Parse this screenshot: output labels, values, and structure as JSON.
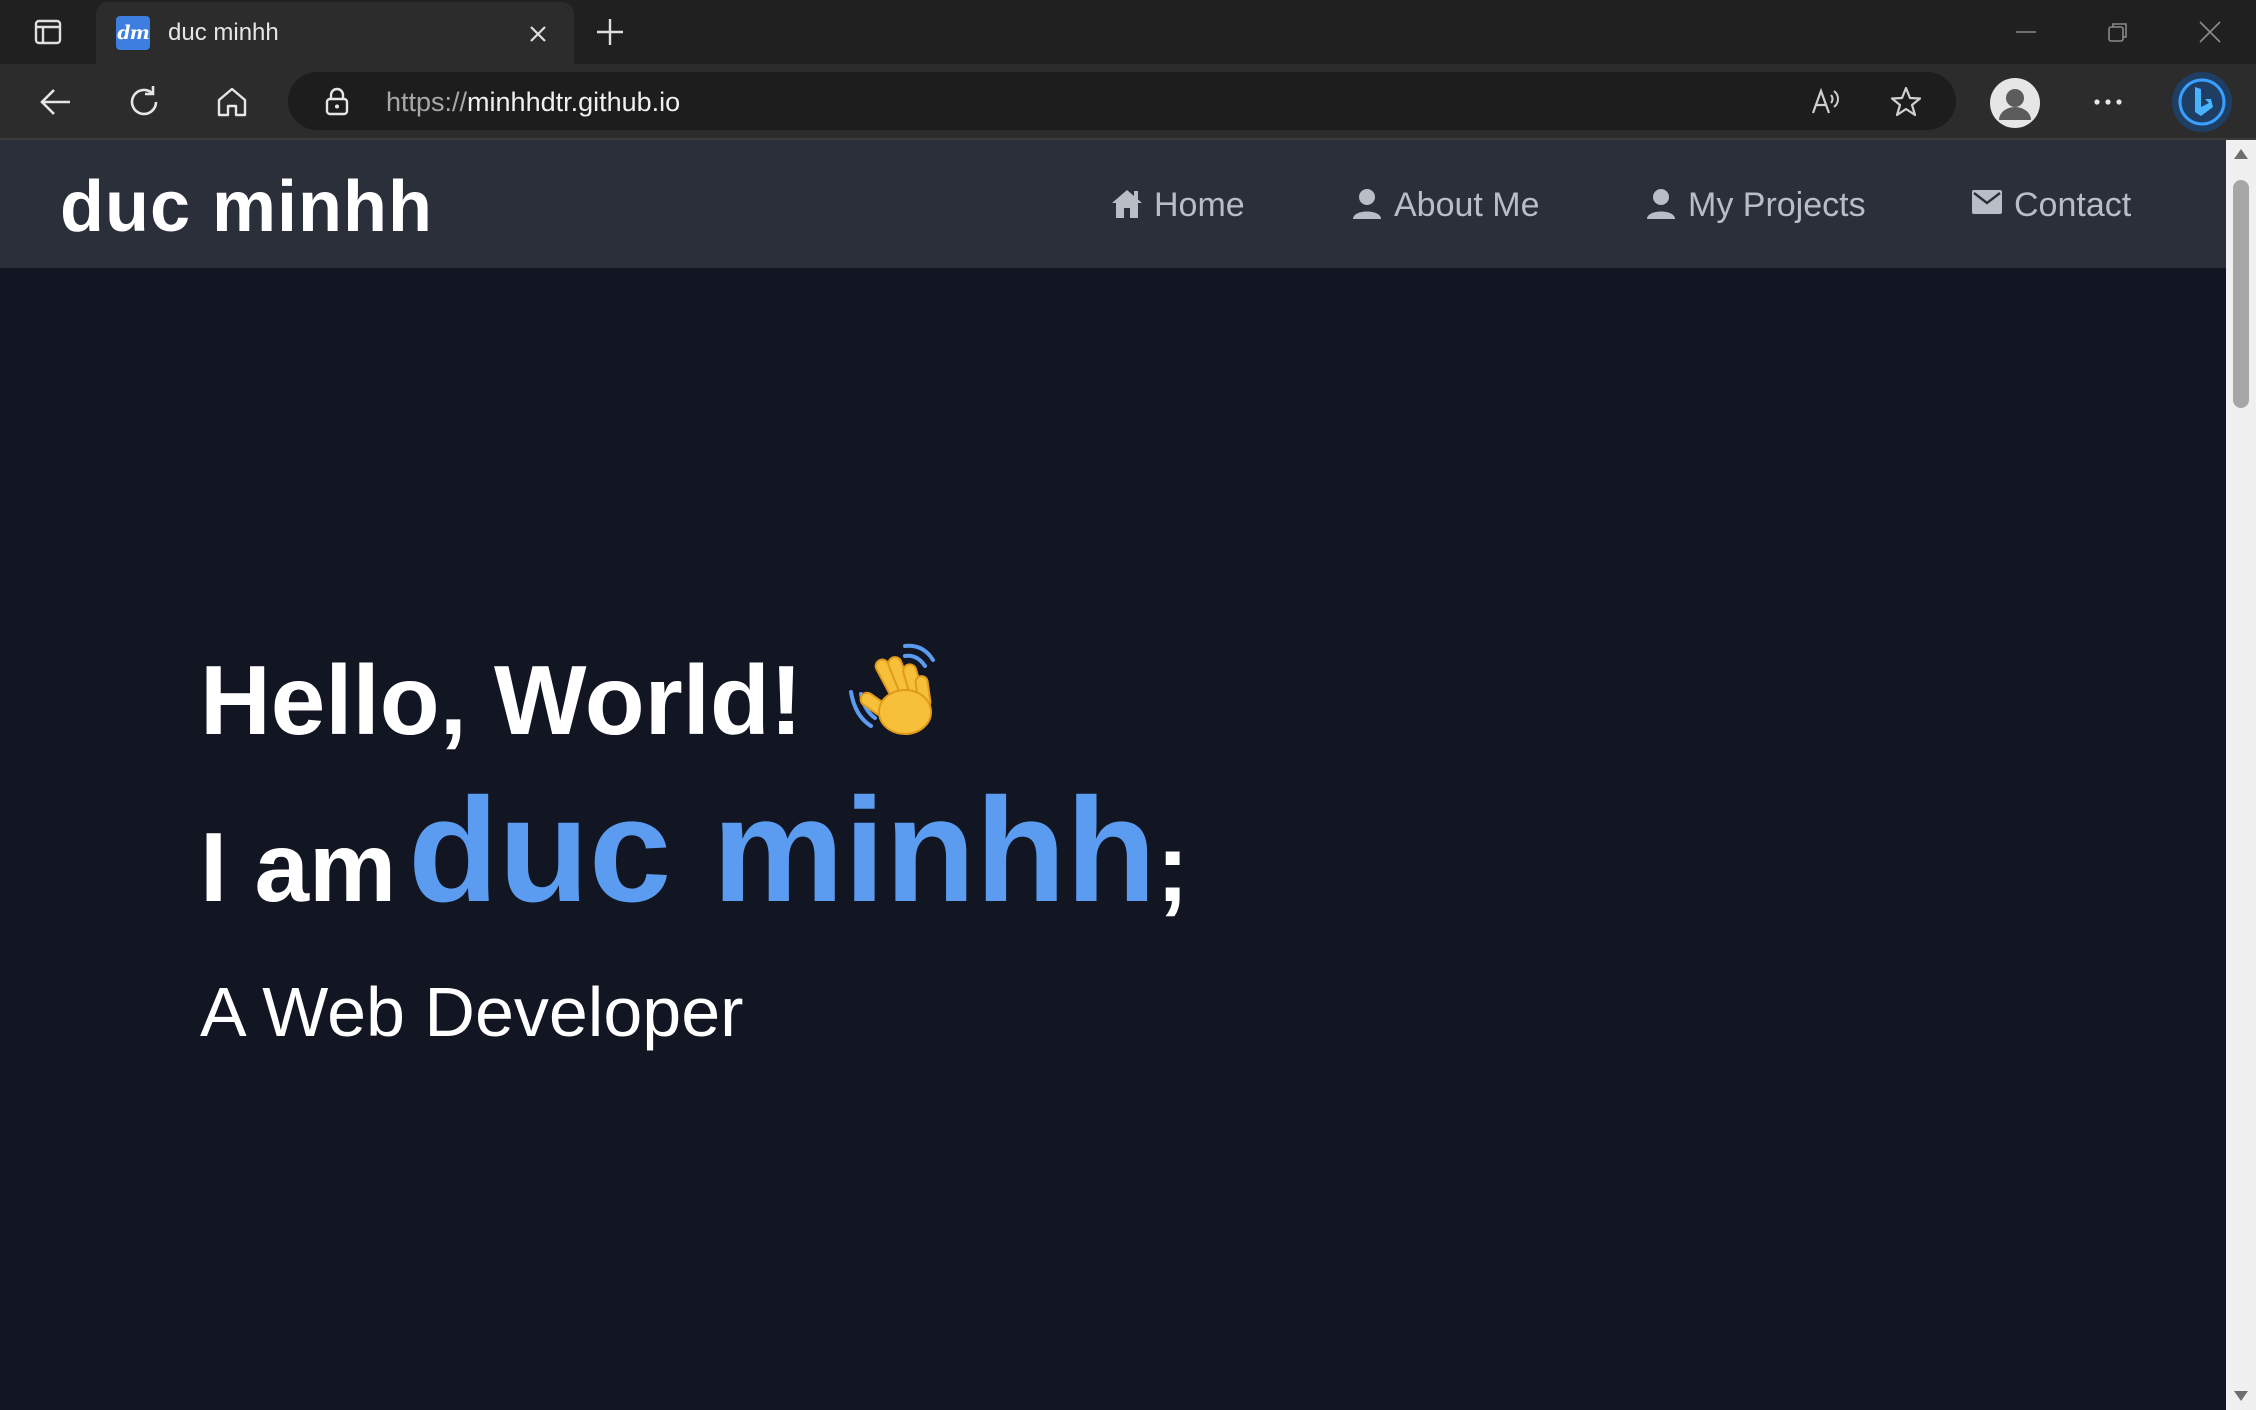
{
  "browser": {
    "tab": {
      "title": "duc minhh",
      "favicon_text": "dm",
      "favicon_color": "#3d7fe0"
    },
    "address": {
      "scheme": "https://",
      "host": "minhhdtr.github.io"
    },
    "icons": [
      "tab-actions-icon",
      "close-icon",
      "plus-icon",
      "minimize-icon",
      "restore-icon",
      "close-window-icon",
      "back-arrow-icon",
      "refresh-icon",
      "home-icon",
      "lock-icon",
      "read-aloud-icon",
      "favorite-star-icon",
      "profile-avatar-icon",
      "more-dots-icon",
      "bing-copilot-icon"
    ]
  },
  "site": {
    "logo": "duc minhh",
    "nav": [
      {
        "label": "Home",
        "icon": "home-icon"
      },
      {
        "label": "About Me",
        "icon": "user-icon"
      },
      {
        "label": "My Projects",
        "icon": "user-icon"
      },
      {
        "label": "Contact",
        "icon": "envelope-icon"
      }
    ],
    "hero": {
      "greeting": "Hello, World!",
      "greeting_emoji": "waving-hand-icon",
      "intro_prefix": "I am",
      "intro_name": "duc minhh",
      "intro_suffix": ";",
      "role": "A Web Developer"
    },
    "colors": {
      "accent": "#5b9cf1",
      "page_bg": "#111622",
      "header_bg": "#2a2f3a",
      "nav_text": "#b9bdc6"
    }
  }
}
